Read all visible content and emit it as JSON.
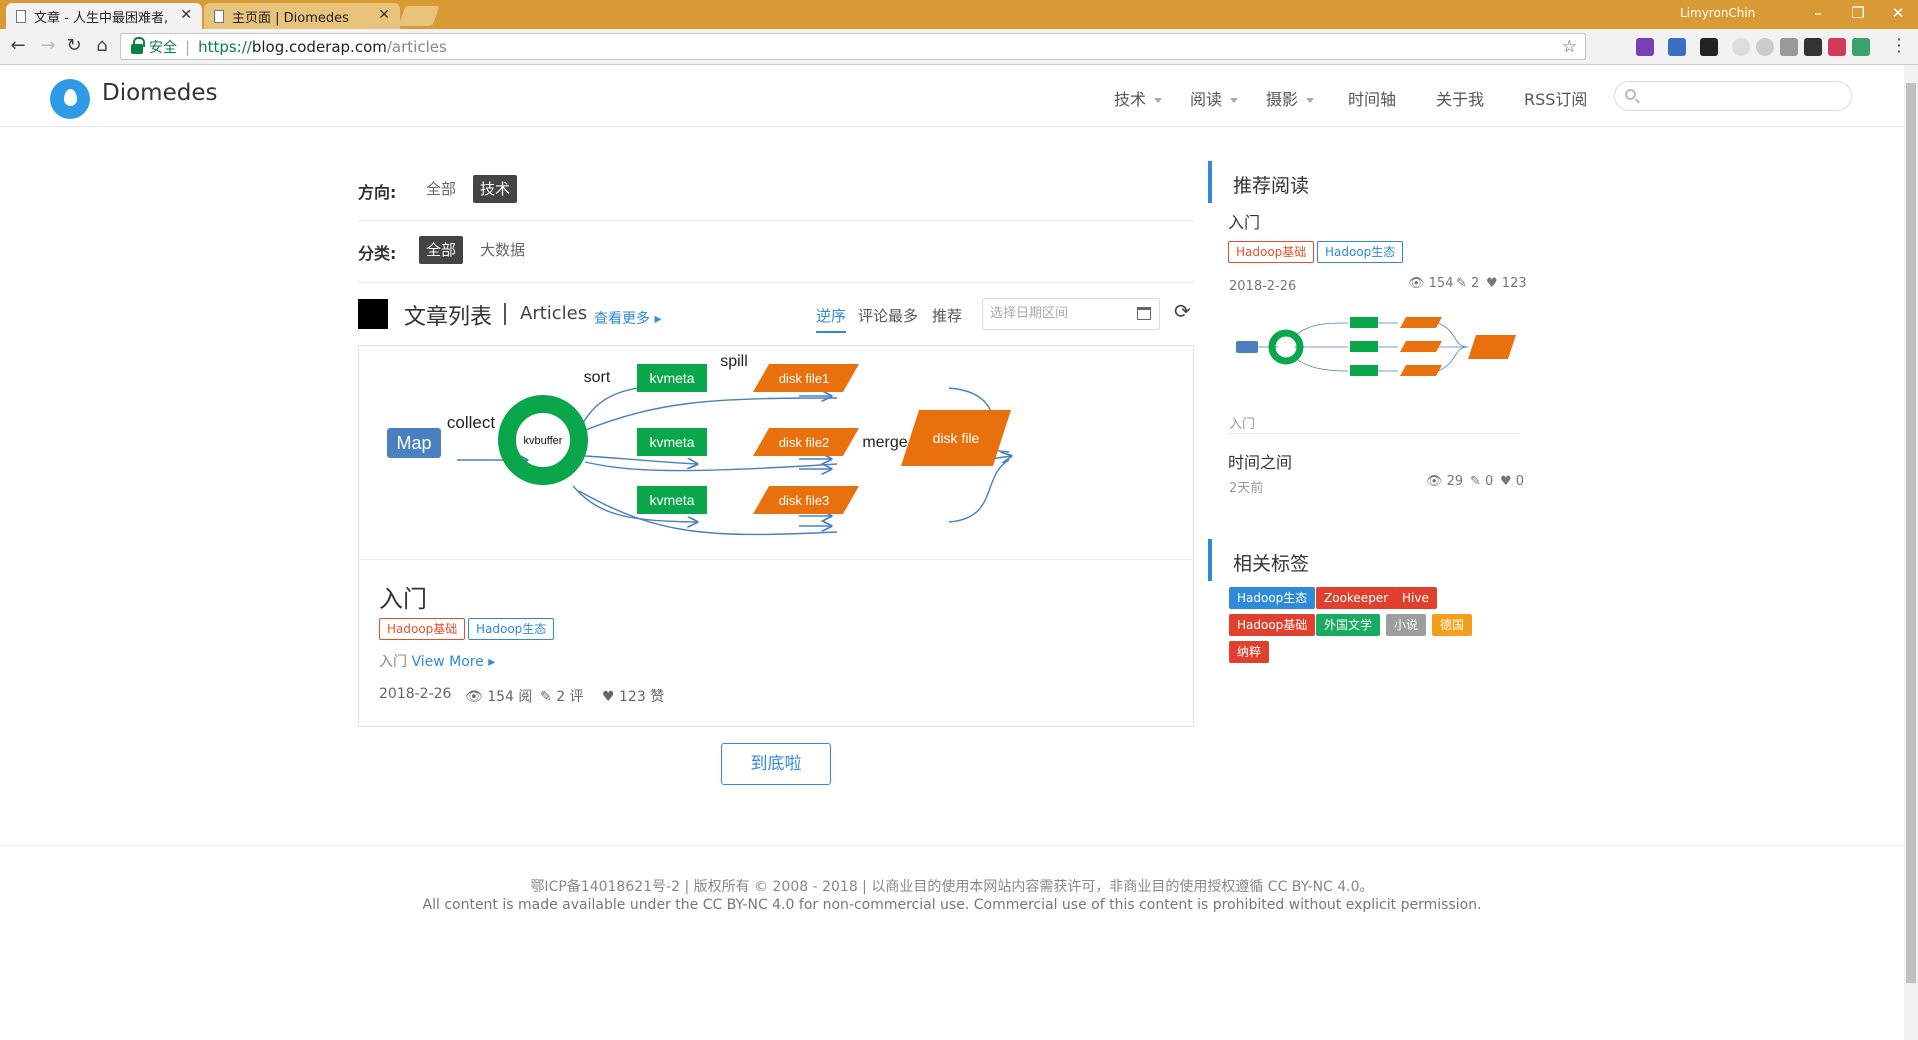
{
  "browser": {
    "tabs": [
      {
        "title": "文章 - 人生中最困难者,"
      },
      {
        "title": "主页面 | Diomedes"
      }
    ],
    "profile_name": "LimyronChin",
    "secure_label": "安全",
    "url_scheme": "https://",
    "url_host": "blog.coderap.com",
    "url_path": "/articles"
  },
  "site": {
    "brand": "Diomedes",
    "nav": [
      {
        "label": "技术"
      },
      {
        "label": "阅读"
      },
      {
        "label": "摄影"
      },
      {
        "label": "时间轴"
      },
      {
        "label": "关于我"
      },
      {
        "label": "RSS订阅"
      }
    ]
  },
  "filters": {
    "direction_label": "方向:",
    "direction_options": [
      "全部",
      "技术"
    ],
    "category_label": "分类:",
    "category_options": [
      "全部",
      "大数据"
    ]
  },
  "list": {
    "title": "文章列表",
    "subtitle": "Articles",
    "view_more": "查看更多",
    "sort_options": [
      "逆序",
      "评论最多",
      "推荐"
    ],
    "date_placeholder": "选择日期区间"
  },
  "diagram": {
    "map": "Map",
    "collect": "collect",
    "kvbuffer": "kvbuffer",
    "sort": "sort",
    "spill": "spill",
    "kvmeta": "kvmeta",
    "disk_file1": "disk file1",
    "disk_file2": "disk file2",
    "disk_file3": "disk file3",
    "merge": "merge",
    "disk_file": "disk file",
    "colors": {
      "green": "#0aa64c",
      "orange": "#e8710e",
      "blue": "#4a80c0"
    }
  },
  "article": {
    "title": "入门",
    "tags": [
      "Hadoop基础",
      "Hadoop生态"
    ],
    "summary": "入门",
    "view_more": "View More",
    "date": "2018-2-26",
    "views": "154 阅",
    "comments": "2 评",
    "likes": "123 赞"
  },
  "bottom_button": "到底啦",
  "sidebar": {
    "recommend_title": "推荐阅读",
    "items": [
      {
        "title": "入门",
        "tags": [
          "Hadoop基础",
          "Hadoop生态"
        ],
        "date": "2018-2-26",
        "views": "154",
        "comments": "2",
        "likes": "123",
        "summary": "入门"
      },
      {
        "title": "时间之间",
        "date": "2天前",
        "views": "29",
        "comments": "0",
        "likes": "0"
      }
    ],
    "tags_title": "相关标签",
    "tags": [
      {
        "label": "Hadoop生态",
        "color": "#2f8ad8"
      },
      {
        "label": "Zookeeper",
        "color": "#e0412e"
      },
      {
        "label": "Hive",
        "color": "#e0412e"
      },
      {
        "label": "Hadoop基础",
        "color": "#e0412e"
      },
      {
        "label": "外国文学",
        "color": "#1aab63"
      },
      {
        "label": "小说",
        "color": "#9e9e9e"
      },
      {
        "label": "德国",
        "color": "#f2a01b"
      },
      {
        "label": "纳粹",
        "color": "#e0412e"
      }
    ]
  },
  "footer": {
    "line1": "鄂ICP备14018621号-2  |   版权所有 © 2008 - 2018  |  以商业目的使用本网站内容需获许可，非商业目的使用授权遵循 CC BY-NC 4.0。",
    "line2": "All content is made available under the CC BY-NC 4.0 for non-commercial use. Commercial use of this content is prohibited without explicit permission."
  }
}
